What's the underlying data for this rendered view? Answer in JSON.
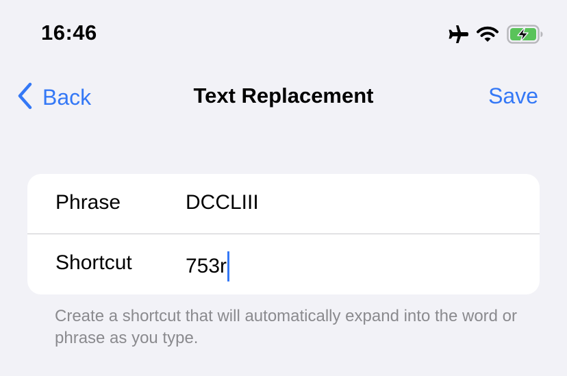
{
  "status_bar": {
    "time": "16:46",
    "icons": [
      "airplane-icon",
      "wifi-icon",
      "battery-charging-icon"
    ]
  },
  "nav": {
    "back_label": "Back",
    "title": "Text Replacement",
    "save_label": "Save"
  },
  "form": {
    "phrase_label": "Phrase",
    "phrase_value": "DCCLIII",
    "shortcut_label": "Shortcut",
    "shortcut_value": "753r"
  },
  "footer_text": "Create a shortcut that will automatically expand into the word or phrase as you type.",
  "colors": {
    "accent": "#3478f6",
    "background": "#f2f2f7",
    "battery": "#5ac35a",
    "secondary_text": "#8a8a8e"
  }
}
